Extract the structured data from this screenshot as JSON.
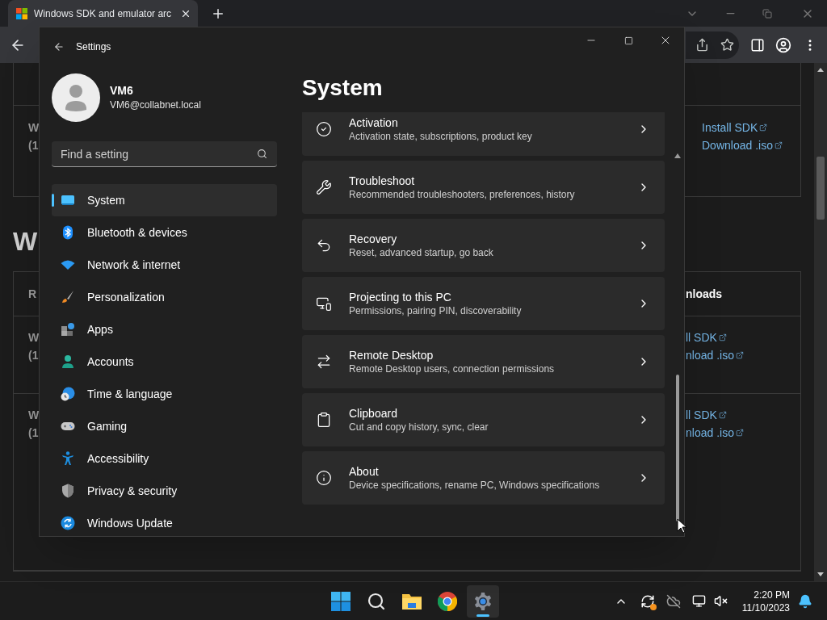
{
  "browser": {
    "tab": {
      "title": "Windows SDK and emulator arc",
      "selected": true
    }
  },
  "page": {
    "box": {
      "rows": [
        {
          "cells": [
            "W",
            "(1"
          ],
          "links": [
            "Install SDK",
            "Download .iso"
          ]
        }
      ]
    },
    "heading": "W",
    "table": {
      "header": {
        "col_1": "R",
        "col_2": "nloads"
      },
      "rows": [
        {
          "cells": [
            "W",
            "(1"
          ],
          "links": [
            "ll SDK",
            "nload .iso"
          ]
        },
        {
          "cells": [
            "W",
            "(1"
          ],
          "links": [
            "ll SDK",
            "nload .iso"
          ]
        }
      ]
    }
  },
  "settings": {
    "title": "Settings",
    "user": {
      "name": "VM6",
      "email": "VM6@collabnet.local"
    },
    "search": {
      "placeholder": "Find a setting"
    },
    "nav": [
      {
        "label": "System",
        "selected": true
      },
      {
        "label": "Bluetooth & devices",
        "selected": false
      },
      {
        "label": "Network & internet",
        "selected": false
      },
      {
        "label": "Personalization",
        "selected": false
      },
      {
        "label": "Apps",
        "selected": false
      },
      {
        "label": "Accounts",
        "selected": false
      },
      {
        "label": "Time & language",
        "selected": false
      },
      {
        "label": "Gaming",
        "selected": false
      },
      {
        "label": "Accessibility",
        "selected": false
      },
      {
        "label": "Privacy & security",
        "selected": false
      },
      {
        "label": "Windows Update",
        "selected": false
      }
    ],
    "heading": "System",
    "cards": [
      {
        "title": "Activation",
        "description": "Activation state, subscriptions, product key"
      },
      {
        "title": "Troubleshoot",
        "description": "Recommended troubleshooters, preferences, history"
      },
      {
        "title": "Recovery",
        "description": "Reset, advanced startup, go back"
      },
      {
        "title": "Projecting to this PC",
        "description": "Permissions, pairing PIN, discoverability"
      },
      {
        "title": "Remote Desktop",
        "description": "Remote Desktop users, connection permissions"
      },
      {
        "title": "Clipboard",
        "description": "Cut and copy history, sync, clear"
      },
      {
        "title": "About",
        "description": "Device specifications, rename PC, Windows specifications"
      }
    ]
  },
  "taskbar": {
    "apps": [
      {
        "selected": false
      },
      {
        "selected": false
      },
      {
        "selected": false
      },
      {
        "selected": false
      },
      {
        "selected": true
      }
    ],
    "time": "2:20 PM",
    "date": "11/10/2023"
  }
}
